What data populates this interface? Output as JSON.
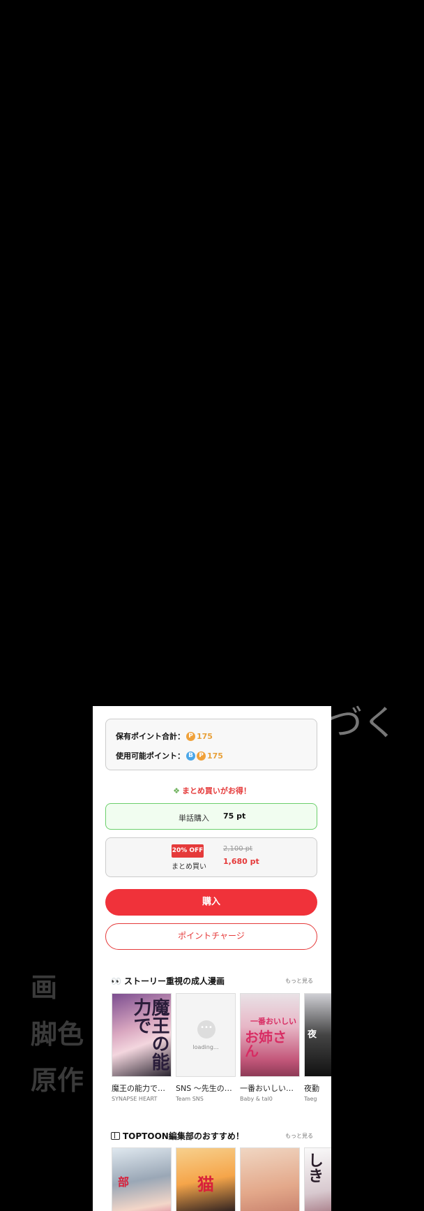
{
  "background": {
    "tsuzuku": "づく",
    "credit_ga": "画",
    "credit_kyakushoku": "脚色",
    "credit_gensaku": "原作"
  },
  "points": {
    "owned_label": "保有ポイント合計：",
    "owned_icon": "P",
    "owned_value": "175",
    "usable_label": "使用可能ポイント：",
    "usable_icon_b": "B",
    "usable_icon_p": "P",
    "usable_value": "175"
  },
  "bulk_note": "まとめ買いがお得！",
  "options": {
    "single_label": "単話購入",
    "single_price": "75 pt",
    "bulk_badge": "20% OFF",
    "bulk_label": "まとめ買い",
    "bulk_old_price": "2,100 pt",
    "bulk_new_price": "1,680 pt"
  },
  "buttons": {
    "buy": "購入",
    "charge": "ポイントチャージ"
  },
  "section1": {
    "title": "ストーリー重視の成人漫画",
    "more": "もっと見る",
    "cards": [
      {
        "title": "魔王の能力で…",
        "author": "SYNAPSE HEART",
        "cover_text": "魔王の能力で"
      },
      {
        "title": "SNS 〜先生の…",
        "author": "Team SNS",
        "loading": "loading..."
      },
      {
        "title": "一番おいしい…",
        "author": "Baby & tal0",
        "cover_text": "お姉さん",
        "cover_sub": "一番おいしい"
      },
      {
        "title": "夜勤",
        "author": "Taeg",
        "cover_text": "夜"
      }
    ]
  },
  "section2": {
    "title": "TOPTOON編集部のおすすめ！",
    "more": "もっと見る",
    "cards": [
      {
        "cover_text": "部"
      },
      {
        "cover_text": "猫"
      },
      {
        "cover_text": ""
      },
      {
        "cover_text": "しき"
      }
    ]
  },
  "colors": {
    "accent_red": "#f0323a",
    "points_orange": "#f0a13a",
    "b_point_blue": "#4aa6e8",
    "selected_green": "#6bcf6b"
  }
}
